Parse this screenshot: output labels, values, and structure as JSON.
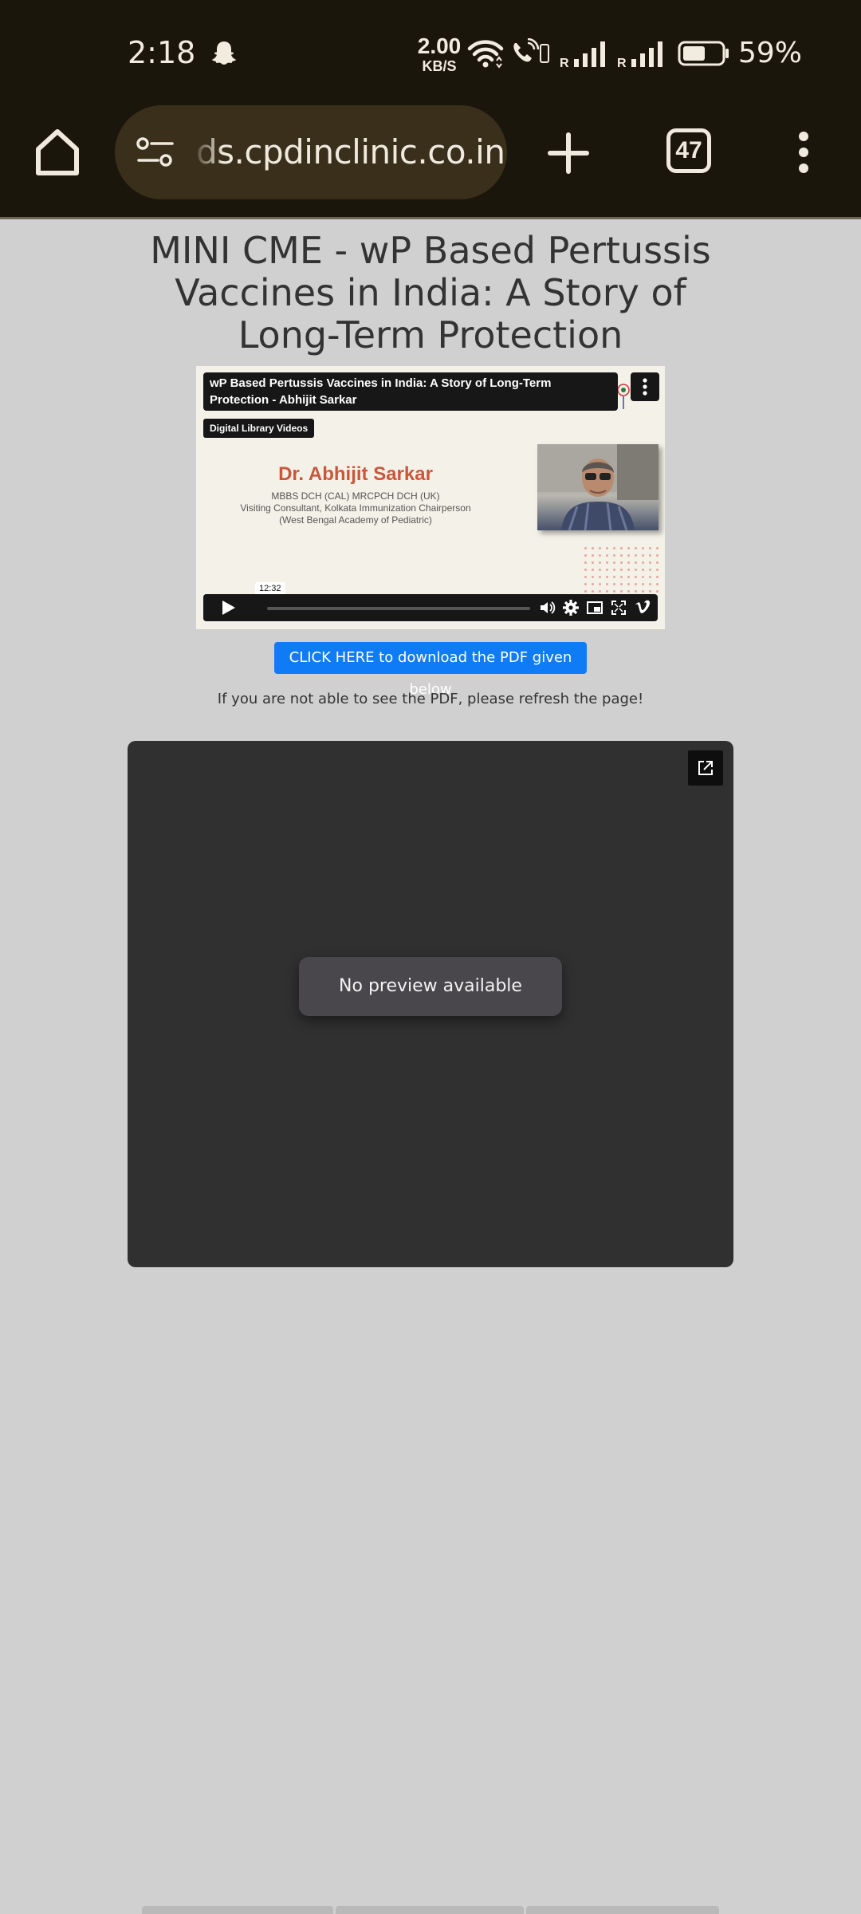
{
  "status_bar": {
    "time": "2:18",
    "net_speed_value": "2.00",
    "net_speed_unit": "KB/S",
    "signal_label": "R",
    "battery_percent": "59%",
    "battery_level": 0.59
  },
  "browser": {
    "url": "ds.cpdinclinic.co.in",
    "tab_count": "47",
    "icons": [
      "home-icon",
      "site-info-icon",
      "plus-icon",
      "tabs-icon",
      "more-vert-icon"
    ]
  },
  "page": {
    "title": "MINI CME - wP Based Pertussis Vaccines in India: A Story of Long-Term Protection",
    "video": {
      "title": "wP Based Pertussis Vaccines in India: A Story of Long-Term Protection - Abhijit Sarkar",
      "badge": "Digital Library Videos",
      "speaker_name": "Dr. Abhijit Sarkar",
      "speaker_line1": "MBBS DCH (CAL) MRCPCH DCH (UK)",
      "speaker_line2": "Visiting Consultant, Kolkata Immunization Chairperson",
      "speaker_line3": "(West Bengal Academy of Pediatric)",
      "duration": "12:32"
    },
    "download_button": "CLICK HERE to download the PDF given below",
    "refresh_note": "If you are not able to see the PDF, please refresh the page!",
    "pdf_viewer": {
      "message": "No preview available"
    }
  },
  "colors": {
    "chrome_bg": "#1b160c",
    "omnibox_bg": "#3a2f1b",
    "page_bg": "#d0d0d0",
    "button_blue": "#0f7cf5",
    "viewer_bg": "#303030",
    "speaker_name": "#c9573a"
  }
}
